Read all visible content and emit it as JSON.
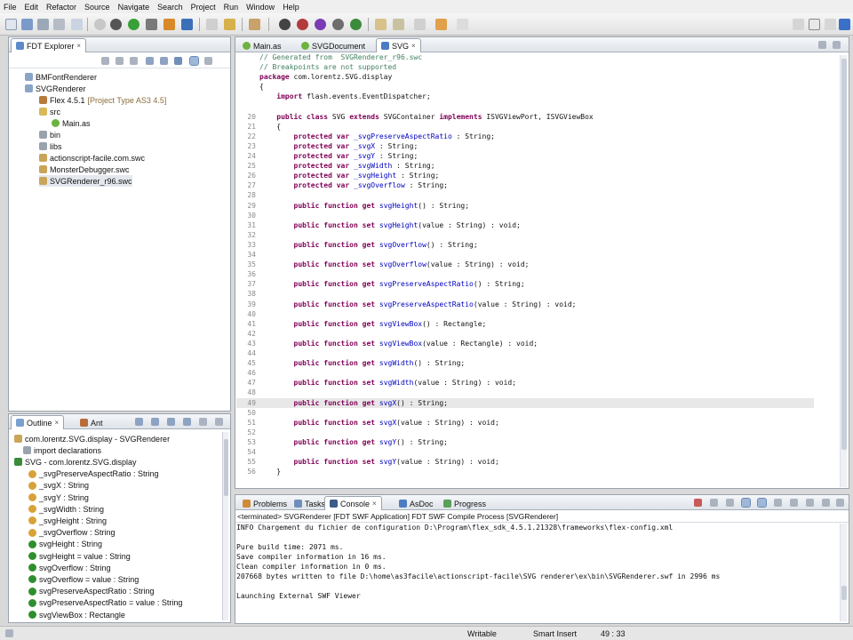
{
  "menu": [
    "File",
    "Edit",
    "Refactor",
    "Source",
    "Navigate",
    "Search",
    "Project",
    "Run",
    "Window",
    "Help"
  ],
  "explorer": {
    "tab": "FDT Explorer",
    "items": [
      {
        "label": "BMFontRenderer",
        "icon": "project-folder-icon"
      },
      {
        "label": "SVGRenderer",
        "icon": "project-folder-icon"
      },
      {
        "label": "Flex 4.5.1",
        "suffix": "[Project Type AS3 4.5]",
        "icon": "library-icon"
      },
      {
        "label": "src",
        "icon": "source-folder-icon"
      },
      {
        "label": "Main.as",
        "icon": "as-file-icon"
      },
      {
        "label": "bin",
        "icon": "folder-icon"
      },
      {
        "label": "libs",
        "icon": "folder-icon"
      },
      {
        "label": "actionscript-facile.com.swc",
        "icon": "swc-icon"
      },
      {
        "label": "MonsterDebugger.swc",
        "icon": "swc-icon"
      },
      {
        "label": "SVGRenderer_r96.swc",
        "icon": "swc-icon"
      }
    ]
  },
  "outline": {
    "tabs": [
      "Outline",
      "Ant"
    ],
    "items": [
      {
        "label": "com.lorentz.SVG.display - SVGRenderer",
        "icon": "package-icon"
      },
      {
        "label": "import declarations",
        "icon": "imports-icon"
      },
      {
        "label": "SVG - com.lorentz.SVG.display",
        "icon": "class-icon"
      },
      {
        "label": "_svgPreserveAspectRatio : String",
        "icon": "field-icon"
      },
      {
        "label": "_svgX : String",
        "icon": "field-icon"
      },
      {
        "label": "_svgY : String",
        "icon": "field-icon"
      },
      {
        "label": "_svgWidth : String",
        "icon": "field-icon"
      },
      {
        "label": "_svgHeight : String",
        "icon": "field-icon"
      },
      {
        "label": "_svgOverflow : String",
        "icon": "field-icon"
      },
      {
        "label": "svgHeight : String",
        "icon": "method-icon"
      },
      {
        "label": "svgHeight = value : String",
        "icon": "method-icon"
      },
      {
        "label": "svgOverflow : String",
        "icon": "method-icon"
      },
      {
        "label": "svgOverflow = value : String",
        "icon": "method-icon"
      },
      {
        "label": "svgPreserveAspectRatio : String",
        "icon": "method-icon"
      },
      {
        "label": "svgPreserveAspectRatio = value : String",
        "icon": "method-icon"
      },
      {
        "label": "svgViewBox : Rectangle",
        "icon": "method-icon"
      }
    ]
  },
  "editor": {
    "tabs": [
      "Main.as",
      "SVGDocument",
      "SVG"
    ],
    "active_tab": "SVG",
    "lines": [
      {
        "n": "",
        "t": "// Generated from  SVGRenderer_r96.swc",
        "c": "cm"
      },
      {
        "n": "",
        "t": "// Breakpoints are not supported",
        "c": "cm"
      },
      {
        "n": "",
        "t": "package com.lorentz.SVG.display",
        "c": ""
      },
      {
        "n": "",
        "t": "{",
        "c": ""
      },
      {
        "n": "",
        "t": "    import flash.events.EventDispatcher;",
        "c": ""
      },
      {
        "n": "",
        "t": "",
        "c": ""
      },
      {
        "n": "20",
        "t": "    public class SVG extends SVGContainer implements ISVGViewPort, ISVGViewBox",
        "c": ""
      },
      {
        "n": "21",
        "t": "    {",
        "c": ""
      },
      {
        "n": "22",
        "t": "        protected var _svgPreserveAspectRatio : String;",
        "c": ""
      },
      {
        "n": "23",
        "t": "        protected var _svgX : String;",
        "c": ""
      },
      {
        "n": "24",
        "t": "        protected var _svgY : String;",
        "c": ""
      },
      {
        "n": "25",
        "t": "        protected var _svgWidth : String;",
        "c": ""
      },
      {
        "n": "26",
        "t": "        protected var _svgHeight : String;",
        "c": ""
      },
      {
        "n": "27",
        "t": "        protected var _svgOverflow : String;",
        "c": ""
      },
      {
        "n": "28",
        "t": "",
        "c": ""
      },
      {
        "n": "29",
        "t": "        public function get svgHeight() : String;",
        "c": ""
      },
      {
        "n": "30",
        "t": "",
        "c": ""
      },
      {
        "n": "31",
        "t": "        public function set svgHeight(value : String) : void;",
        "c": ""
      },
      {
        "n": "32",
        "t": "",
        "c": ""
      },
      {
        "n": "33",
        "t": "        public function get svgOverflow() : String;",
        "c": ""
      },
      {
        "n": "34",
        "t": "",
        "c": ""
      },
      {
        "n": "35",
        "t": "        public function set svgOverflow(value : String) : void;",
        "c": ""
      },
      {
        "n": "36",
        "t": "",
        "c": ""
      },
      {
        "n": "37",
        "t": "        public function get svgPreserveAspectRatio() : String;",
        "c": ""
      },
      {
        "n": "38",
        "t": "",
        "c": ""
      },
      {
        "n": "39",
        "t": "        public function set svgPreserveAspectRatio(value : String) : void;",
        "c": ""
      },
      {
        "n": "40",
        "t": "",
        "c": ""
      },
      {
        "n": "41",
        "t": "        public function get svgViewBox() : Rectangle;",
        "c": ""
      },
      {
        "n": "42",
        "t": "",
        "c": ""
      },
      {
        "n": "43",
        "t": "        public function set svgViewBox(value : Rectangle) : void;",
        "c": ""
      },
      {
        "n": "44",
        "t": "",
        "c": ""
      },
      {
        "n": "45",
        "t": "        public function get svgWidth() : String;",
        "c": ""
      },
      {
        "n": "46",
        "t": "",
        "c": ""
      },
      {
        "n": "47",
        "t": "        public function set svgWidth(value : String) : void;",
        "c": ""
      },
      {
        "n": "48",
        "t": "",
        "c": ""
      },
      {
        "n": "49",
        "t": "        public function get svgX() : String;",
        "c": "hl"
      },
      {
        "n": "50",
        "t": "",
        "c": ""
      },
      {
        "n": "51",
        "t": "        public function set svgX(value : String) : void;",
        "c": ""
      },
      {
        "n": "52",
        "t": "",
        "c": ""
      },
      {
        "n": "53",
        "t": "        public function get svgY() : String;",
        "c": ""
      },
      {
        "n": "54",
        "t": "",
        "c": ""
      },
      {
        "n": "55",
        "t": "        public function set svgY(value : String) : void;",
        "c": ""
      },
      {
        "n": "56",
        "t": "    }",
        "c": ""
      }
    ]
  },
  "console": {
    "tabs": [
      "Problems",
      "Tasks",
      "Console",
      "AsDoc",
      "Progress"
    ],
    "active_tab": "Console",
    "header": "<terminated> SVGRenderer [FDT SWF Application] FDT SWF Compile Process [SVGRenderer]",
    "lines": [
      "INFO Chargement du fichier de configuration D:\\Program\\flex_sdk_4.5.1.21328\\frameworks\\flex-config.xml",
      "",
      "Pure build time: 2071 ms.",
      "Save compiler information in 16 ms.",
      "Clean compiler information in 0 ms.",
      "207668 bytes written to file D:\\home\\as3facile\\actionscript-facile\\SVG renderer\\ex\\bin\\SVGRenderer.swf in 2996 ms",
      "",
      "Launching External SWF Viewer"
    ]
  },
  "status": {
    "mode": "Writable",
    "insert": "Smart Insert",
    "position": "49 : 33"
  },
  "colors": {
    "keyword": "#7f0055",
    "comment": "#3f7f5f",
    "identifier": "#0000c0",
    "selection": "#3c9a3c"
  }
}
